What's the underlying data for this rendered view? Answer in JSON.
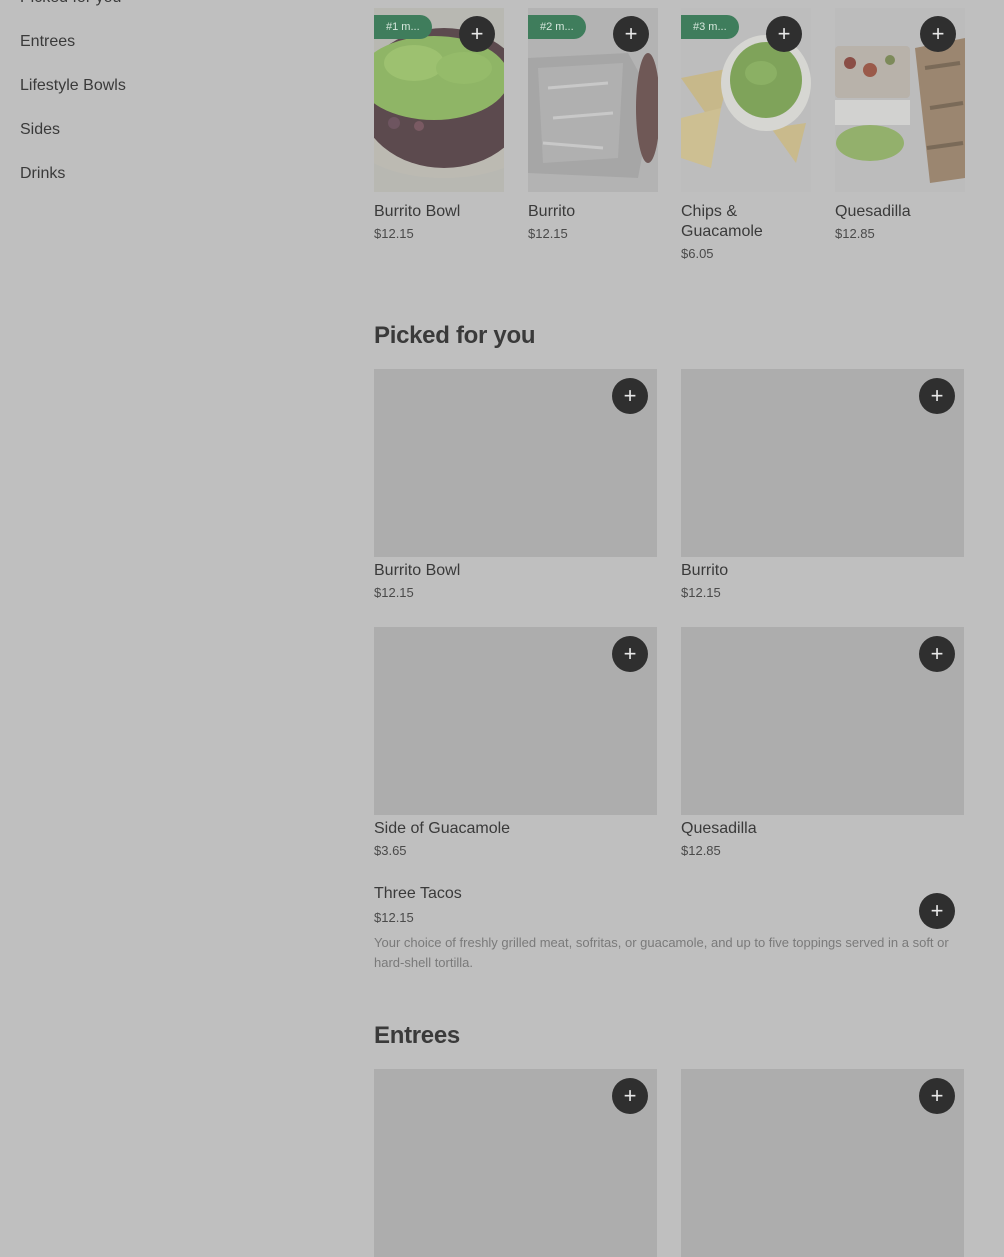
{
  "sidebar": {
    "items": [
      {
        "label": "Picked for you"
      },
      {
        "label": "Entrees"
      },
      {
        "label": "Lifestyle Bowls"
      },
      {
        "label": "Sides"
      },
      {
        "label": "Drinks"
      }
    ]
  },
  "popular": {
    "items": [
      {
        "badge": "#1 m...",
        "name": "Burrito Bowl",
        "price": "$12.15"
      },
      {
        "badge": "#2 m...",
        "name": "Burrito",
        "price": "$12.15"
      },
      {
        "badge": "#3 m...",
        "name": "Chips & Guacamole",
        "price": "$6.05"
      },
      {
        "badge": "",
        "name": "Quesadilla",
        "price": "$12.85"
      }
    ]
  },
  "picked": {
    "title": "Picked for you",
    "items": [
      {
        "name": "Burrito Bowl",
        "price": "$12.15"
      },
      {
        "name": "Burrito",
        "price": "$12.15"
      },
      {
        "name": "Side of Guacamole",
        "price": "$3.65"
      },
      {
        "name": "Quesadilla",
        "price": "$12.85"
      }
    ],
    "list_item": {
      "name": "Three Tacos",
      "price": "$12.15",
      "description": "Your choice of freshly grilled meat, sofritas, or guacamole, and up to five toppings served in a soft or hard-shell tortilla."
    }
  },
  "entrees": {
    "title": "Entrees"
  },
  "icons": {
    "add": "plus-icon"
  },
  "colors": {
    "badge_bg": "#3f7d5c",
    "add_button_bg": "#2f2f2f",
    "overlay_bg": "#bfbfbf"
  }
}
